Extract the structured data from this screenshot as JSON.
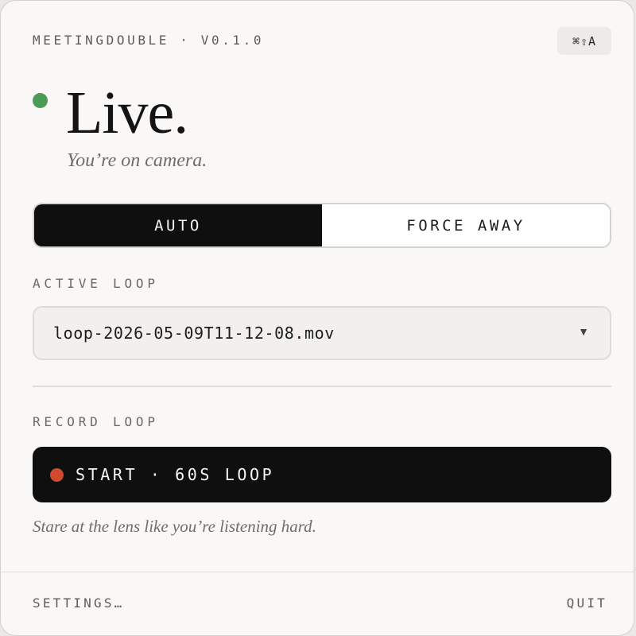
{
  "header": {
    "app_title": "MEETINGDOUBLE · V0.1.0",
    "shortcut": "⌘⇧A"
  },
  "status": {
    "title": "Live.",
    "subtitle": "You’re on camera.",
    "indicator_color": "#4a9a5a"
  },
  "mode_toggle": {
    "options": [
      {
        "label": "AUTO",
        "selected": true
      },
      {
        "label": "FORCE AWAY",
        "selected": false
      }
    ]
  },
  "active_loop": {
    "label": "ACTIVE LOOP",
    "selected_value": "loop-2026-05-09T11-12-08.mov",
    "caret": "▼"
  },
  "record_loop": {
    "label": "RECORD LOOP",
    "button_label": "START · 60S LOOP",
    "dot_color": "#d24a2e",
    "hint": "Stare at the lens like you’re listening hard."
  },
  "footer": {
    "settings_label": "SETTINGS…",
    "quit_label": "QUIT"
  },
  "colors": {
    "accent_dark": "#0f0f0f",
    "background": "#f9f8f6"
  }
}
